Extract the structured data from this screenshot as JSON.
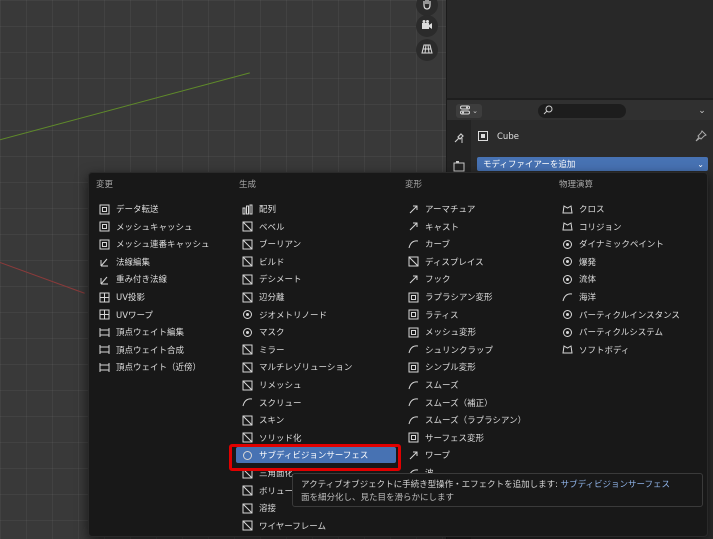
{
  "properties": {
    "object_name": "Cube",
    "add_modifier_label": "モディファイアーを追加"
  },
  "menu": {
    "columns": [
      {
        "header": "変更",
        "items": [
          {
            "label": "データ転送",
            "icon": "data-transfer-icon"
          },
          {
            "label": "メッシュキャッシュ",
            "icon": "mesh-cache-icon"
          },
          {
            "label": "メッシュ連番キャッシュ",
            "icon": "mesh-sequence-cache-icon"
          },
          {
            "label": "法線編集",
            "icon": "normal-edit-icon"
          },
          {
            "label": "重み付き法線",
            "icon": "weighted-normal-icon"
          },
          {
            "label": "UV投影",
            "icon": "uv-project-icon"
          },
          {
            "label": "UVワープ",
            "icon": "uv-warp-icon"
          },
          {
            "label": "頂点ウェイト編集",
            "icon": "vertex-weight-edit-icon"
          },
          {
            "label": "頂点ウェイト合成",
            "icon": "vertex-weight-mix-icon"
          },
          {
            "label": "頂点ウェイト（近傍）",
            "icon": "vertex-weight-proximity-icon"
          }
        ]
      },
      {
        "header": "生成",
        "items": [
          {
            "label": "配列",
            "icon": "array-icon"
          },
          {
            "label": "ベベル",
            "icon": "bevel-icon"
          },
          {
            "label": "ブーリアン",
            "icon": "boolean-icon"
          },
          {
            "label": "ビルド",
            "icon": "build-icon"
          },
          {
            "label": "デシメート",
            "icon": "decimate-icon"
          },
          {
            "label": "辺分離",
            "icon": "edge-split-icon"
          },
          {
            "label": "ジオメトリノード",
            "icon": "geometry-nodes-icon"
          },
          {
            "label": "マスク",
            "icon": "mask-icon"
          },
          {
            "label": "ミラー",
            "icon": "mirror-icon"
          },
          {
            "label": "マルチレゾリューション",
            "icon": "multires-icon"
          },
          {
            "label": "リメッシュ",
            "icon": "remesh-icon"
          },
          {
            "label": "スクリュー",
            "icon": "screw-icon"
          },
          {
            "label": "スキン",
            "icon": "skin-icon"
          },
          {
            "label": "ソリッド化",
            "icon": "solidify-icon"
          },
          {
            "label": "サブディビジョンサーフェス",
            "icon": "subdivision-surface-icon"
          },
          {
            "label": "三角面化",
            "icon": "triangulate-icon"
          },
          {
            "label": "ボリュー",
            "icon": "volume-icon"
          },
          {
            "label": "溶接",
            "icon": "weld-icon"
          },
          {
            "label": "ワイヤーフレーム",
            "icon": "wireframe-icon"
          }
        ]
      },
      {
        "header": "変形",
        "items": [
          {
            "label": "アーマチュア",
            "icon": "armature-icon"
          },
          {
            "label": "キャスト",
            "icon": "cast-icon"
          },
          {
            "label": "カーブ",
            "icon": "curve-icon"
          },
          {
            "label": "ディスプレイス",
            "icon": "displace-icon"
          },
          {
            "label": "フック",
            "icon": "hook-icon"
          },
          {
            "label": "ラプラシアン変形",
            "icon": "laplacian-deform-icon"
          },
          {
            "label": "ラティス",
            "icon": "lattice-icon"
          },
          {
            "label": "メッシュ変形",
            "icon": "mesh-deform-icon"
          },
          {
            "label": "シュリンクラップ",
            "icon": "shrinkwrap-icon"
          },
          {
            "label": "シンプル変形",
            "icon": "simple-deform-icon"
          },
          {
            "label": "スムーズ",
            "icon": "smooth-icon"
          },
          {
            "label": "スムーズ（補正）",
            "icon": "smooth-corrective-icon"
          },
          {
            "label": "スムーズ（ラプラシアン）",
            "icon": "smooth-laplacian-icon"
          },
          {
            "label": "サーフェス変形",
            "icon": "surface-deform-icon"
          },
          {
            "label": "ワープ",
            "icon": "warp-icon"
          },
          {
            "label": "波",
            "icon": "wave-icon"
          }
        ]
      },
      {
        "header": "物理演算",
        "items": [
          {
            "label": "クロス",
            "icon": "cloth-icon"
          },
          {
            "label": "コリジョン",
            "icon": "collision-icon"
          },
          {
            "label": "ダイナミックペイント",
            "icon": "dynamic-paint-icon"
          },
          {
            "label": "爆発",
            "icon": "explode-icon"
          },
          {
            "label": "流体",
            "icon": "fluid-icon"
          },
          {
            "label": "海洋",
            "icon": "ocean-icon"
          },
          {
            "label": "パーティクルインスタンス",
            "icon": "particle-instance-icon"
          },
          {
            "label": "パーティクルシステム",
            "icon": "particle-system-icon"
          },
          {
            "label": "ソフトボディ",
            "icon": "soft-body-icon"
          }
        ]
      }
    ],
    "highlighted_item": "サブディビジョンサーフェス"
  },
  "tooltip": {
    "prefix": "アクティブオブジェクトに手続き型操作・エフェクトを追加します: ",
    "operation": "サブディビジョンサーフェス",
    "line2": "面を細分化し、見た目を滑らかにします"
  },
  "colors": {
    "accent": "#4772b3",
    "highlight_box": "#e00000"
  }
}
